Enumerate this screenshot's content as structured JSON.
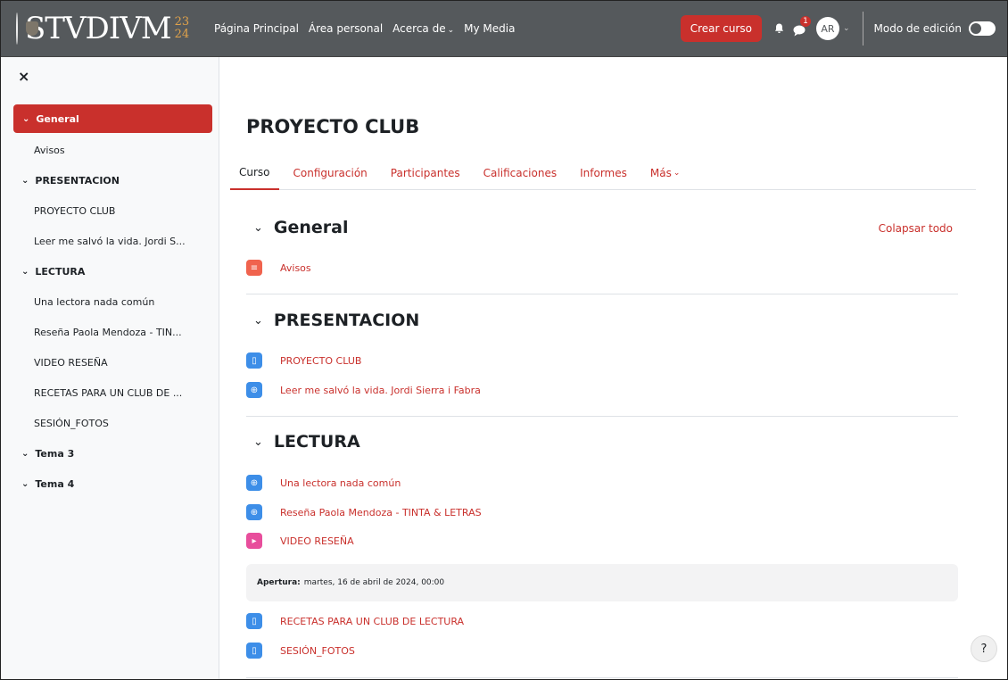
{
  "brand": {
    "word": "STVDIVM",
    "year_top": "23",
    "year_bottom": "24"
  },
  "nav": {
    "links": [
      "Página Principal",
      "Área personal",
      "Acerca de",
      "My Media"
    ],
    "create_course": "Crear curso",
    "message_badge": "1",
    "avatar_initials": "AR",
    "edit_mode_label": "Modo de edición"
  },
  "drawer": {
    "close_glyph": "×",
    "items": [
      {
        "type": "section",
        "label": "General",
        "active": true
      },
      {
        "type": "item",
        "label": "Avisos"
      },
      {
        "type": "section",
        "label": "PRESENTACION"
      },
      {
        "type": "item",
        "label": "PROYECTO CLUB"
      },
      {
        "type": "item",
        "label": "Leer me salvó la vida. Jordi S..."
      },
      {
        "type": "section",
        "label": "LECTURA"
      },
      {
        "type": "item",
        "label": "Una lectora nada común"
      },
      {
        "type": "item",
        "label": "Reseña Paola Mendoza - TIN..."
      },
      {
        "type": "item",
        "label": "VIDEO RESEÑA"
      },
      {
        "type": "item",
        "label": "RECETAS PARA UN CLUB DE ..."
      },
      {
        "type": "item",
        "label": "SESIÓN_FOTOS"
      },
      {
        "type": "section",
        "label": "Tema 3"
      },
      {
        "type": "section",
        "label": "Tema 4"
      }
    ]
  },
  "main": {
    "course_title": "PROYECTO CLUB",
    "tabs": [
      "Curso",
      "Configuración",
      "Participantes",
      "Calificaciones",
      "Informes",
      "Más"
    ],
    "collapse_all": "Colapsar todo",
    "sections": {
      "general": {
        "title": "General",
        "activities": [
          "Avisos"
        ]
      },
      "presentacion": {
        "title": "PRESENTACION",
        "activities": [
          "PROYECTO CLUB",
          "Leer me salvó la vida. Jordi Sierra i Fabra"
        ]
      },
      "lectura": {
        "title": "LECTURA",
        "activities": [
          "Una lectora nada común",
          "Reseña Paola Mendoza - TINTA & LETRAS",
          "VIDEO RESEÑA"
        ],
        "restriction_label": "Apertura:",
        "restriction_text": "martes, 16 de abril de 2024, 00:00",
        "restricted_activities": [
          "RECETAS PARA UN CLUB DE LECTURA",
          "SESIÓN_FOTOS"
        ]
      }
    },
    "help": "?"
  },
  "colors": {
    "navbar": "#55595c",
    "accent": "#c9302c",
    "page_icon": "#3d8ee8",
    "forum_icon": "#f0634e",
    "video_icon": "#e84e9c"
  }
}
